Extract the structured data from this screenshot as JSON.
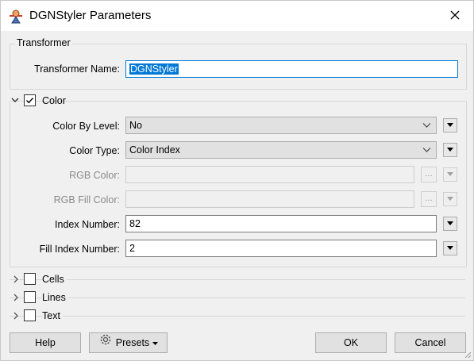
{
  "window": {
    "title": "DGNStyler Parameters"
  },
  "transformer_group": {
    "title": "Transformer",
    "name_label": "Transformer Name:",
    "name_value": "DGNStyler"
  },
  "color_section": {
    "label": "Color",
    "checked": true,
    "expanded": true,
    "fields": {
      "color_by_level": {
        "label": "Color By Level:",
        "value": "No"
      },
      "color_type": {
        "label": "Color Type:",
        "value": "Color Index"
      },
      "rgb_color": {
        "label": "RGB Color:",
        "value": ""
      },
      "rgb_fill_color": {
        "label": "RGB Fill Color:",
        "value": ""
      },
      "index_number": {
        "label": "Index Number:",
        "value": "82"
      },
      "fill_index_number": {
        "label": "Fill Index Number:",
        "value": "2"
      }
    },
    "ellipsis_label": "..."
  },
  "collapsed_sections": [
    {
      "label": "Cells",
      "checked": false
    },
    {
      "label": "Lines",
      "checked": false
    },
    {
      "label": "Text",
      "checked": false
    }
  ],
  "buttons": {
    "help": "Help",
    "presets": "Presets",
    "ok": "OK",
    "cancel": "Cancel"
  },
  "icons": {
    "app": "fme-workbench-icon",
    "close": "close-icon",
    "dropdown": "chevron-down-icon",
    "menu": "triangle-down-icon",
    "expand": "chevron-right-icon",
    "collapse": "chevron-down-icon",
    "presets": "gear-icon"
  },
  "colors": {
    "accent": "#0078d7",
    "window_bg": "#f0f0f0"
  }
}
